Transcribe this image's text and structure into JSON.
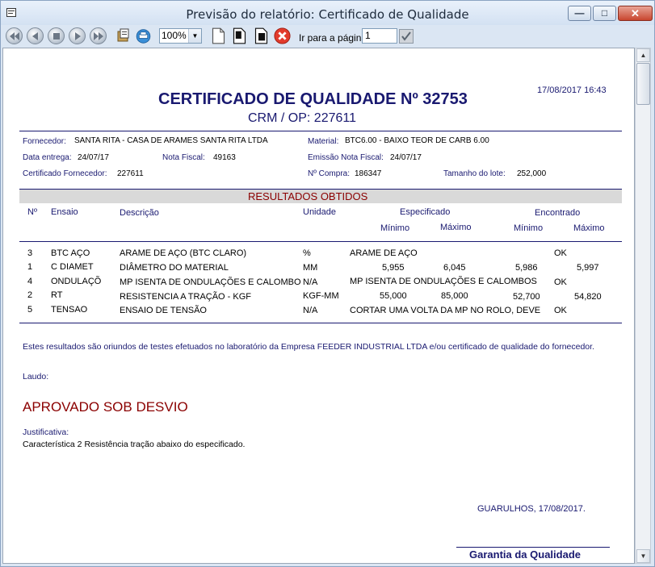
{
  "window": {
    "title": "Previsão do relatório: Certificado de Qualidade",
    "controls": {
      "minimize": "—",
      "maximize": "□",
      "close": "✕"
    }
  },
  "toolbar": {
    "zoom": "100%",
    "goto_label": "Ir para a página",
    "goto_value": "1",
    "icons": [
      "first-page-icon",
      "prev-page-icon",
      "stop-icon",
      "next-page-icon",
      "last-page-icon",
      "export-icon",
      "print-icon",
      "new-page-icon",
      "save-icon",
      "save-as-icon",
      "close-report-icon",
      "confirm-icon"
    ]
  },
  "report": {
    "datetime": "17/08/2017  16:43",
    "title": "CERTIFICADO DE QUALIDADE Nº 32753",
    "subtitle_prefix": "CRM / OP:",
    "subtitle_value": "227611",
    "info": {
      "fornecedor_label": "Fornecedor:",
      "fornecedor_value": "SANTA RITA - CASA DE ARAMES SANTA RITA LTDA",
      "material_label": "Material:",
      "material_value": "BTC6.00 - BAIXO TEOR DE CARB 6.00",
      "data_entrega_label": "Data entrega:",
      "data_entrega_value": "24/07/17",
      "nota_fiscal_label": "Nota Fiscal:",
      "nota_fiscal_value": "49163",
      "emissao_label": "Emissão Nota Fiscal:",
      "emissao_value": "24/07/17",
      "cert_forn_label": "Certificado Fornecedor:",
      "cert_forn_value": "227611",
      "n_compra_label": "Nº Compra:",
      "n_compra_value": "186347",
      "tamanho_label": "Tamanho do lote:",
      "tamanho_value": "252,000"
    },
    "results_title": "RESULTADOS OBTIDOS",
    "columns": {
      "n": "Nº",
      "ensaio": "Ensaio",
      "descricao": "Descrição",
      "unidade": "Unidade",
      "especificado": "Especificado",
      "encontrado": "Encontrado",
      "esp_min": "Mínimo",
      "esp_max": "Máximo",
      "enc_min": "Mínimo",
      "enc_max": "Máximo"
    },
    "rows": [
      {
        "n": "3",
        "ensaio": "BTC AÇO",
        "descricao": "ARAME DE AÇO (BTC CLARO)",
        "unidade": "%",
        "esp_min": "ARAME DE AÇO",
        "esp_max": "",
        "enc_min": "OK",
        "enc_max": ""
      },
      {
        "n": "1",
        "ensaio": "C DIAMET",
        "descricao": "DIÂMETRO DO MATERIAL",
        "unidade": "MM",
        "esp_min": "5,955",
        "esp_max": "6,045",
        "enc_min": "5,986",
        "enc_max": "5,997"
      },
      {
        "n": "4",
        "ensaio": "ONDULAÇÕ",
        "descricao": "MP ISENTA DE ONDULAÇÕES E CALOMBO",
        "unidade": "N/A",
        "esp_min": "MP ISENTA DE ONDULAÇÕES E CALOMBOS",
        "esp_max": "",
        "enc_min": "OK",
        "enc_max": ""
      },
      {
        "n": "2",
        "ensaio": "RT",
        "descricao": "RESISTENCIA A TRAÇÃO - KGF",
        "unidade": "KGF-MM",
        "esp_min": "55,000",
        "esp_max": "85,000",
        "enc_min": "52,700",
        "enc_max": "54,820"
      },
      {
        "n": "5",
        "ensaio": "TENSAO",
        "descricao": "ENSAIO DE TENSÃO",
        "unidade": "N/A",
        "esp_min": "CORTAR UMA VOLTA DA MP NO ROLO, DEVE",
        "esp_max": "",
        "enc_min": "OK",
        "enc_max": ""
      }
    ],
    "note": "Estes resultados são oriundos de testes efetuados no laboratório da Empresa FEEDER INDUSTRIAL LTDA e/ou certificado de qualidade do fornecedor.",
    "laudo_label": "Laudo:",
    "laudo_value": "APROVADO SOB DESVIO",
    "justificativa_label": "Justificativa:",
    "justificativa_value": "Característica 2 Resistência tração abaixo do especificado.",
    "place_date": "GUARULHOS, 17/08/2017.",
    "signature": "Garantia da Qualidade"
  },
  "colors": {
    "navy": "#191970",
    "maroon": "#8b0000",
    "band": "#d9d9d9"
  }
}
